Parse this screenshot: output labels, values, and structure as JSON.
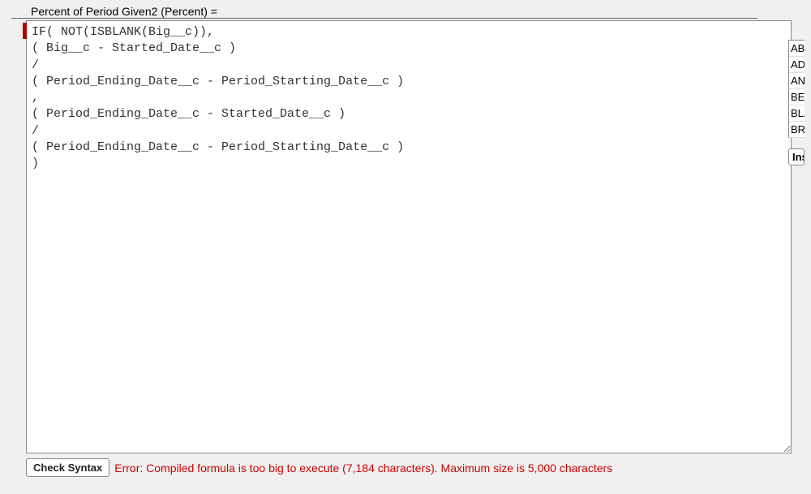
{
  "field_label": "Percent of Period Given2 (Percent) =",
  "formula": "IF( NOT(ISBLANK(Big__c)),\n( Big__c - Started_Date__c )\n/\n( Period_Ending_Date__c - Period_Starting_Date__c )\n,\n( Period_Ending_Date__c - Started_Date__c )\n/\n( Period_Ending_Date__c - Period_Starting_Date__c )\n)",
  "check_syntax_label": "Check Syntax",
  "error_message": "Error: Compiled formula is too big to execute (7,184 characters). Maximum size is 5,000 characters",
  "functions": [
    "ABS",
    "ADD",
    "AND",
    "BEGINS",
    "BLANK",
    "BR"
  ],
  "insert_label": "Insert"
}
